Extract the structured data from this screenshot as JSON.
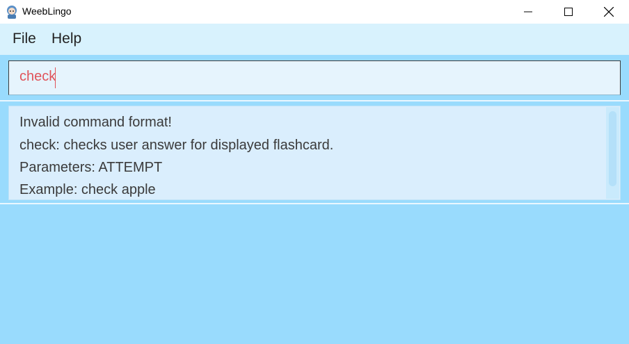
{
  "window": {
    "title": "WeebLingo",
    "icon": "app-icon"
  },
  "menu": {
    "file": "File",
    "help": "Help"
  },
  "command_box": {
    "value": "check"
  },
  "result": {
    "lines": [
      "Invalid command format!",
      "check: checks user answer for displayed flashcard.",
      "Parameters: ATTEMPT",
      "Example: check apple"
    ]
  }
}
